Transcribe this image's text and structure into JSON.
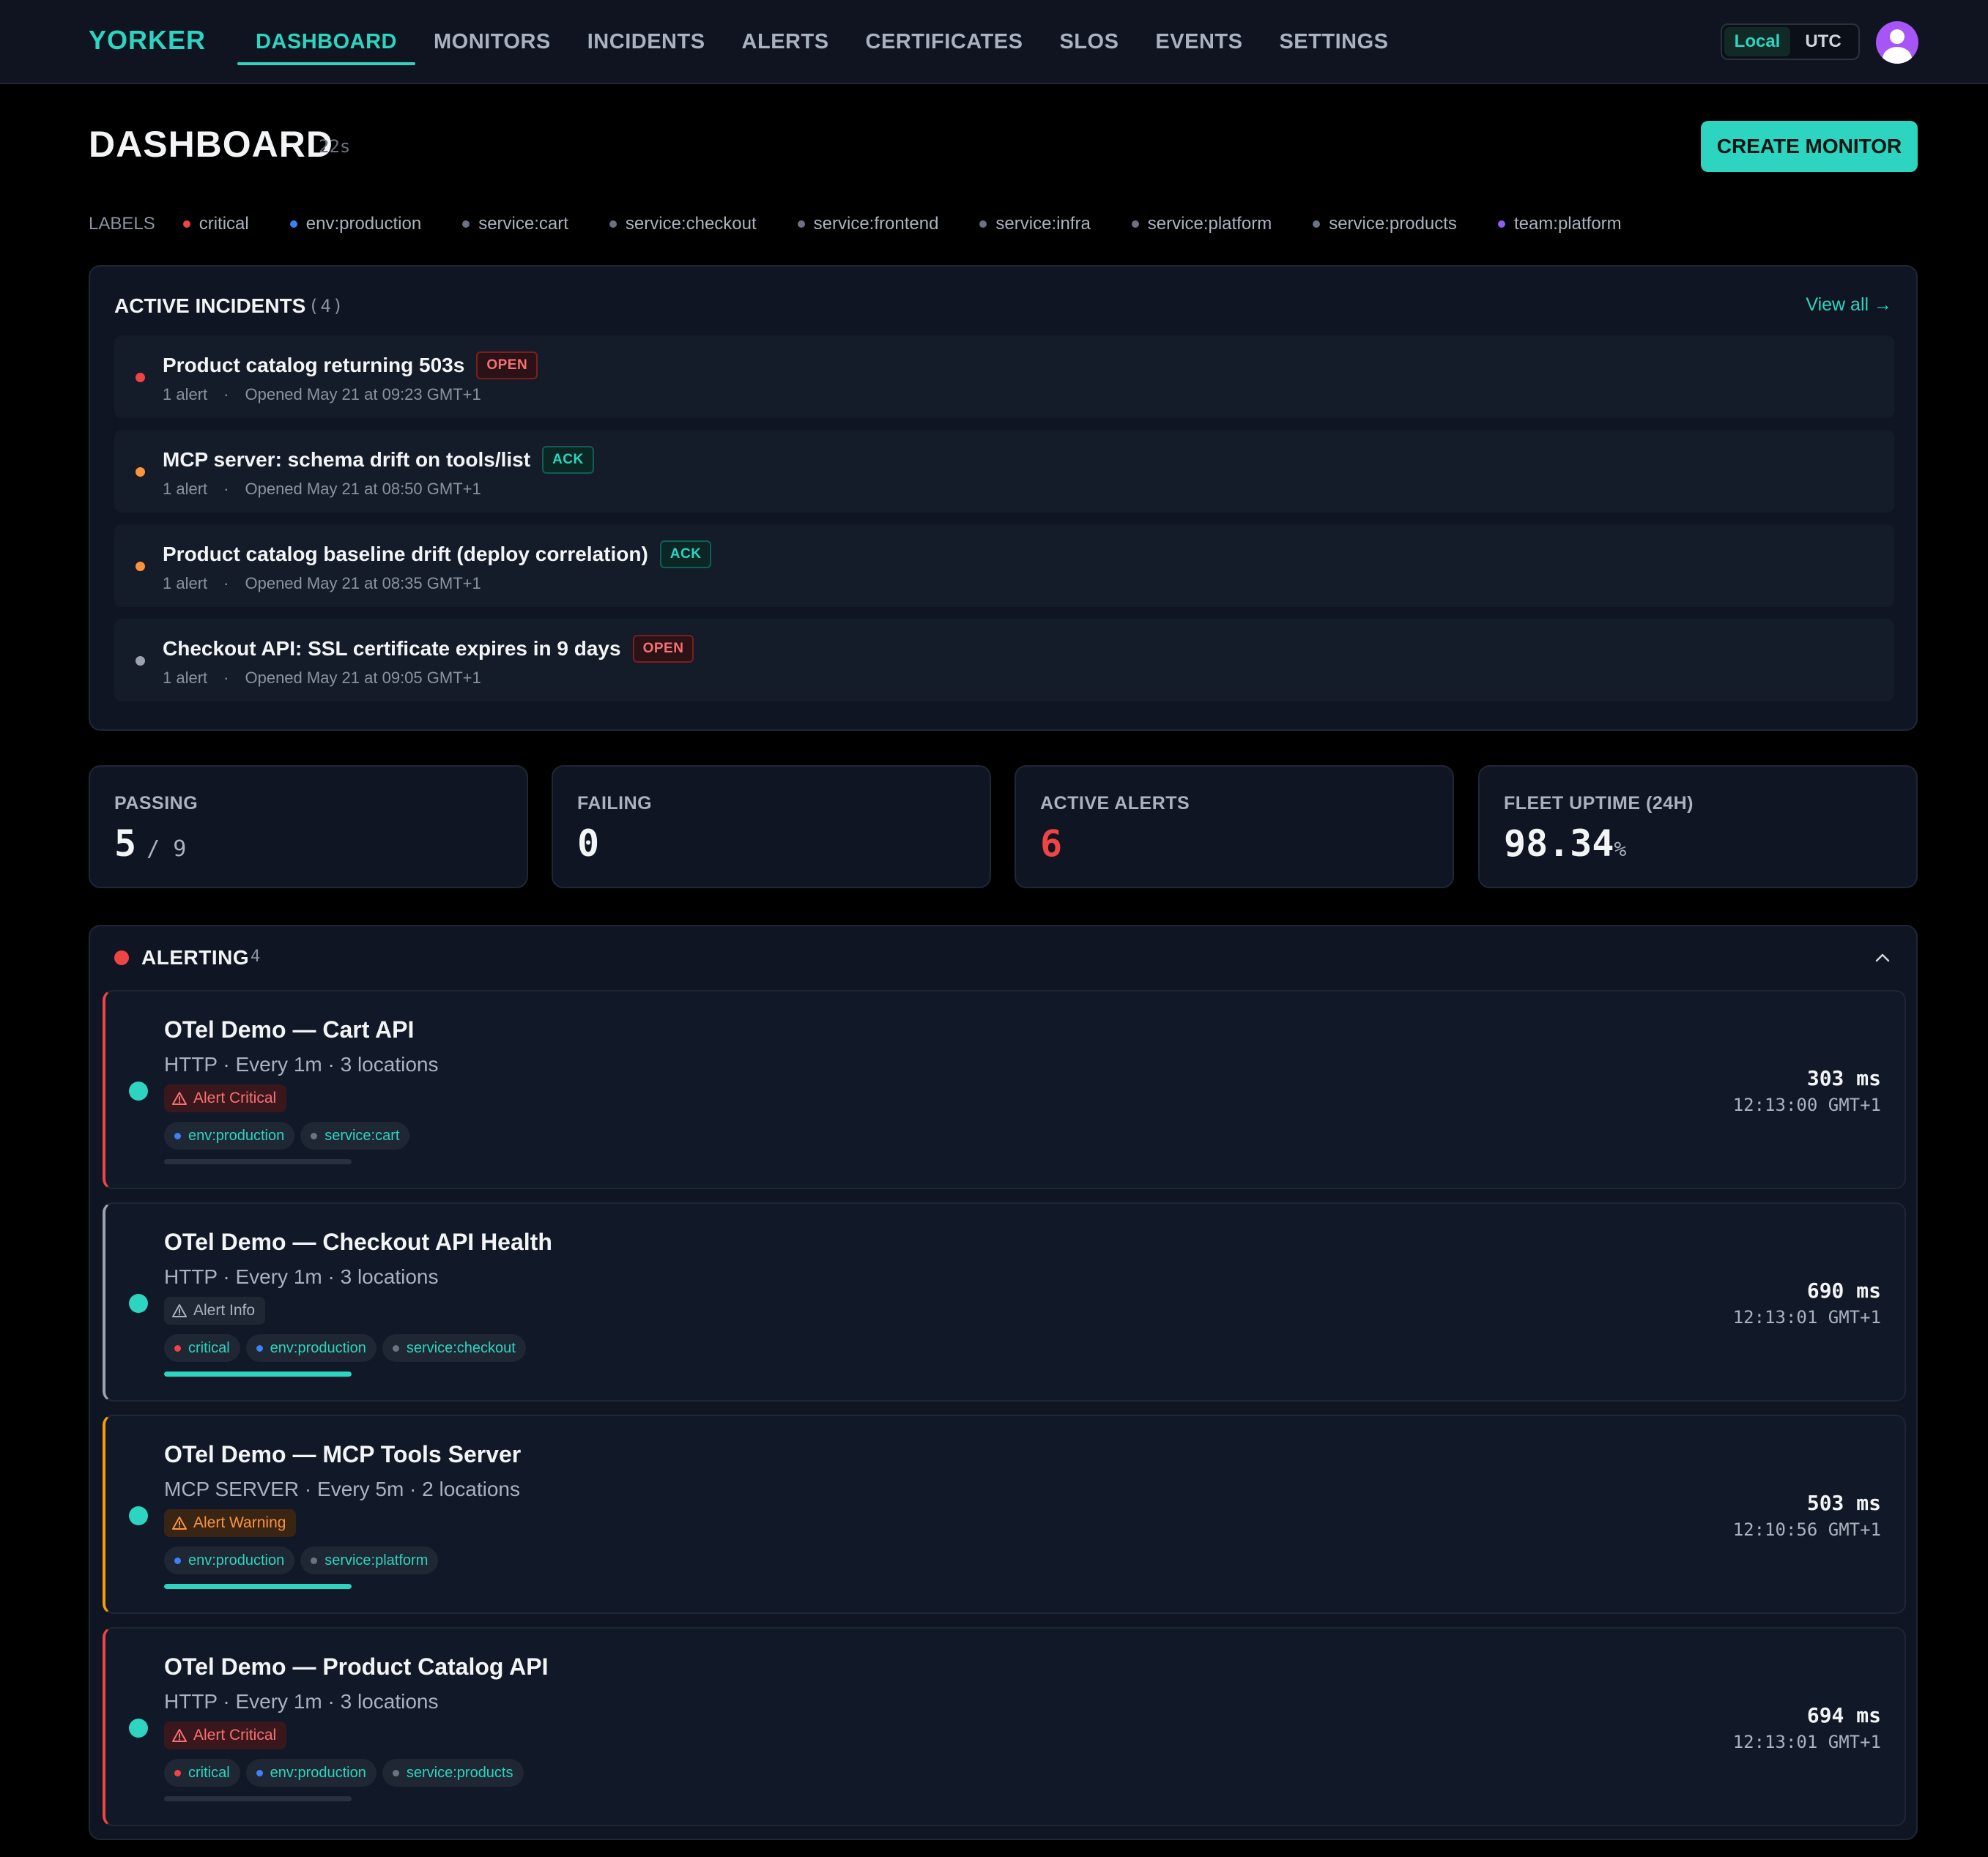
{
  "app": {
    "logo": "YORKER"
  },
  "nav": {
    "tabs": [
      "DASHBOARD",
      "MONITORS",
      "INCIDENTS",
      "ALERTS",
      "CERTIFICATES",
      "SLOS",
      "EVENTS",
      "SETTINGS"
    ],
    "active_tab": "DASHBOARD",
    "timezone": {
      "options": [
        "Local",
        "UTC"
      ],
      "selected": "Local"
    }
  },
  "header": {
    "title": "DASHBOARD",
    "refresh": "22s",
    "create_button": "CREATE MONITOR"
  },
  "labels": {
    "title": "LABELS",
    "items": [
      {
        "text": "critical",
        "color": "#ef4444"
      },
      {
        "text": "env:production",
        "color": "#3b82f6"
      },
      {
        "text": "service:cart",
        "color": "#6b7280"
      },
      {
        "text": "service:checkout",
        "color": "#6b7280"
      },
      {
        "text": "service:frontend",
        "color": "#6b7280"
      },
      {
        "text": "service:infra",
        "color": "#6b7280"
      },
      {
        "text": "service:platform",
        "color": "#6b7280"
      },
      {
        "text": "service:products",
        "color": "#6b7280"
      },
      {
        "text": "team:platform",
        "color": "#8b5cf6"
      }
    ]
  },
  "incidents": {
    "title": "ACTIVE INCIDENTS",
    "count": "(4)",
    "view_all": "View all →",
    "items": [
      {
        "name": "Product catalog returning 503s",
        "status": "OPEN",
        "dot_color": "#ef4444",
        "alerts": "1 alert",
        "sep": "·",
        "opened": "Opened May 21 at 09:23 GMT+1"
      },
      {
        "name": "MCP server: schema drift on tools/list",
        "status": "ACK",
        "dot_color": "#fb923c",
        "alerts": "1 alert",
        "sep": "·",
        "opened": "Opened May 21 at 08:50 GMT+1"
      },
      {
        "name": "Product catalog baseline drift (deploy correlation)",
        "status": "ACK",
        "dot_color": "#fb923c",
        "alerts": "1 alert",
        "sep": "·",
        "opened": "Opened May 21 at 08:35 GMT+1"
      },
      {
        "name": "Checkout API: SSL certificate expires in 9 days",
        "status": "OPEN",
        "dot_color": "#9ca3af",
        "alerts": "1 alert",
        "sep": "·",
        "opened": "Opened May 21 at 09:05 GMT+1"
      }
    ]
  },
  "stats": {
    "passing": {
      "label": "PASSING",
      "value": "5",
      "total": "/ 9"
    },
    "failing": {
      "label": "FAILING",
      "value": "0"
    },
    "active_alerts": {
      "label": "ACTIVE ALERTS",
      "value": "6",
      "color": "#ef4444"
    },
    "fleet_uptime": {
      "label": "FLEET UPTIME (24H)",
      "value": "98.34",
      "unit": "%"
    }
  },
  "alerting": {
    "title": "ALERTING",
    "count": "4",
    "monitors": [
      {
        "name": "OTel Demo — Cart API",
        "subtitle": "HTTP · Every 1m · 3 locations",
        "severity": "Alert Critical",
        "severity_level": "critical",
        "accent": "#ef4444",
        "tags": [
          {
            "text": "env:production",
            "color": "#3b82f6"
          },
          {
            "text": "service:cart",
            "color": "#6b7280"
          }
        ],
        "health": 0,
        "latency": "303 ms",
        "time": "12:13:00 GMT+1"
      },
      {
        "name": "OTel Demo — Checkout API Health",
        "subtitle": "HTTP · Every 1m · 3 locations",
        "severity": "Alert Info",
        "severity_level": "info",
        "accent": "#9ca3af",
        "tags": [
          {
            "text": "critical",
            "color": "#ef4444"
          },
          {
            "text": "env:production",
            "color": "#3b82f6"
          },
          {
            "text": "service:checkout",
            "color": "#6b7280"
          }
        ],
        "health": 1,
        "latency": "690 ms",
        "time": "12:13:01 GMT+1"
      },
      {
        "name": "OTel Demo — MCP Tools Server",
        "subtitle": "MCP SERVER · Every 5m · 2 locations",
        "severity": "Alert Warning",
        "severity_level": "warning",
        "accent": "#f59e0b",
        "tags": [
          {
            "text": "env:production",
            "color": "#3b82f6"
          },
          {
            "text": "service:platform",
            "color": "#6b7280"
          }
        ],
        "health": 1,
        "latency": "503 ms",
        "time": "12:10:56 GMT+1"
      },
      {
        "name": "OTel Demo — Product Catalog API",
        "subtitle": "HTTP · Every 1m · 3 locations",
        "severity": "Alert Critical",
        "severity_level": "critical",
        "accent": "#ef4444",
        "tags": [
          {
            "text": "critical",
            "color": "#ef4444"
          },
          {
            "text": "env:production",
            "color": "#3b82f6"
          },
          {
            "text": "service:products",
            "color": "#6b7280"
          }
        ],
        "health": 0,
        "latency": "694 ms",
        "time": "12:13:01 GMT+1"
      }
    ]
  }
}
